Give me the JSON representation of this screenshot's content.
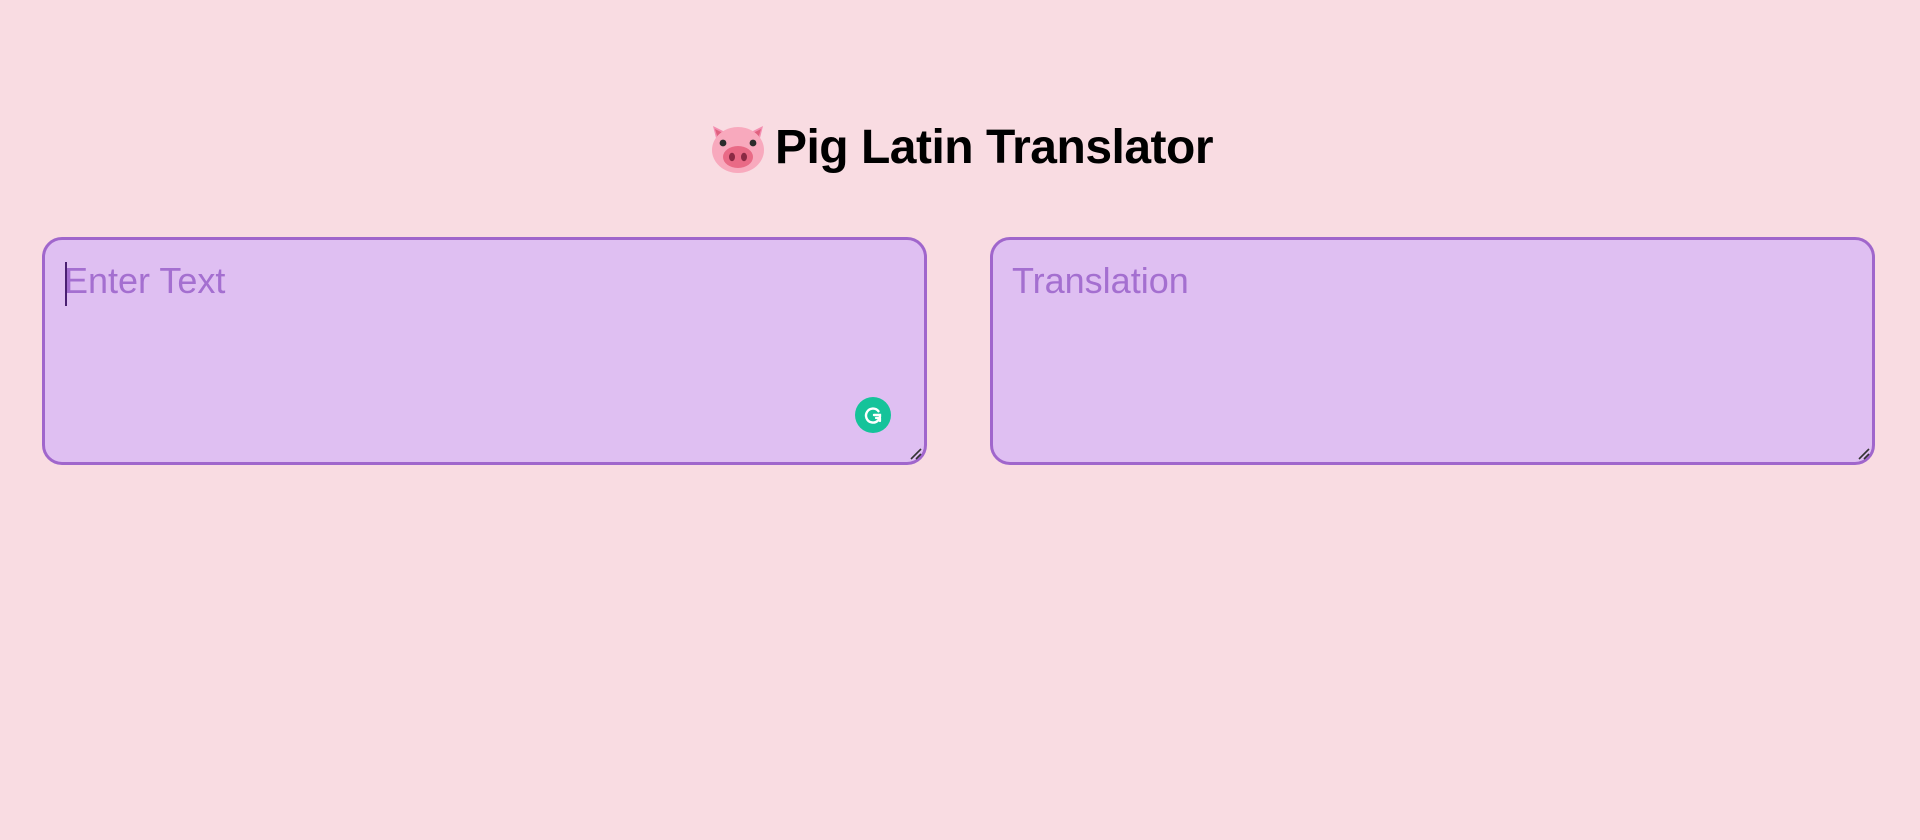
{
  "header": {
    "title": "Pig Latin Translator",
    "icon": "pig-face-icon"
  },
  "input_box": {
    "placeholder": "Enter Text",
    "value": ""
  },
  "output_box": {
    "placeholder": "Translation",
    "value": ""
  },
  "extensions": {
    "grammarly_icon": "grammarly-icon"
  },
  "colors": {
    "background": "#f9dce2",
    "box_fill": "#dfbff2",
    "box_border": "#a066cc",
    "placeholder": "#a46fd0",
    "grammarly": "#15c39a"
  }
}
